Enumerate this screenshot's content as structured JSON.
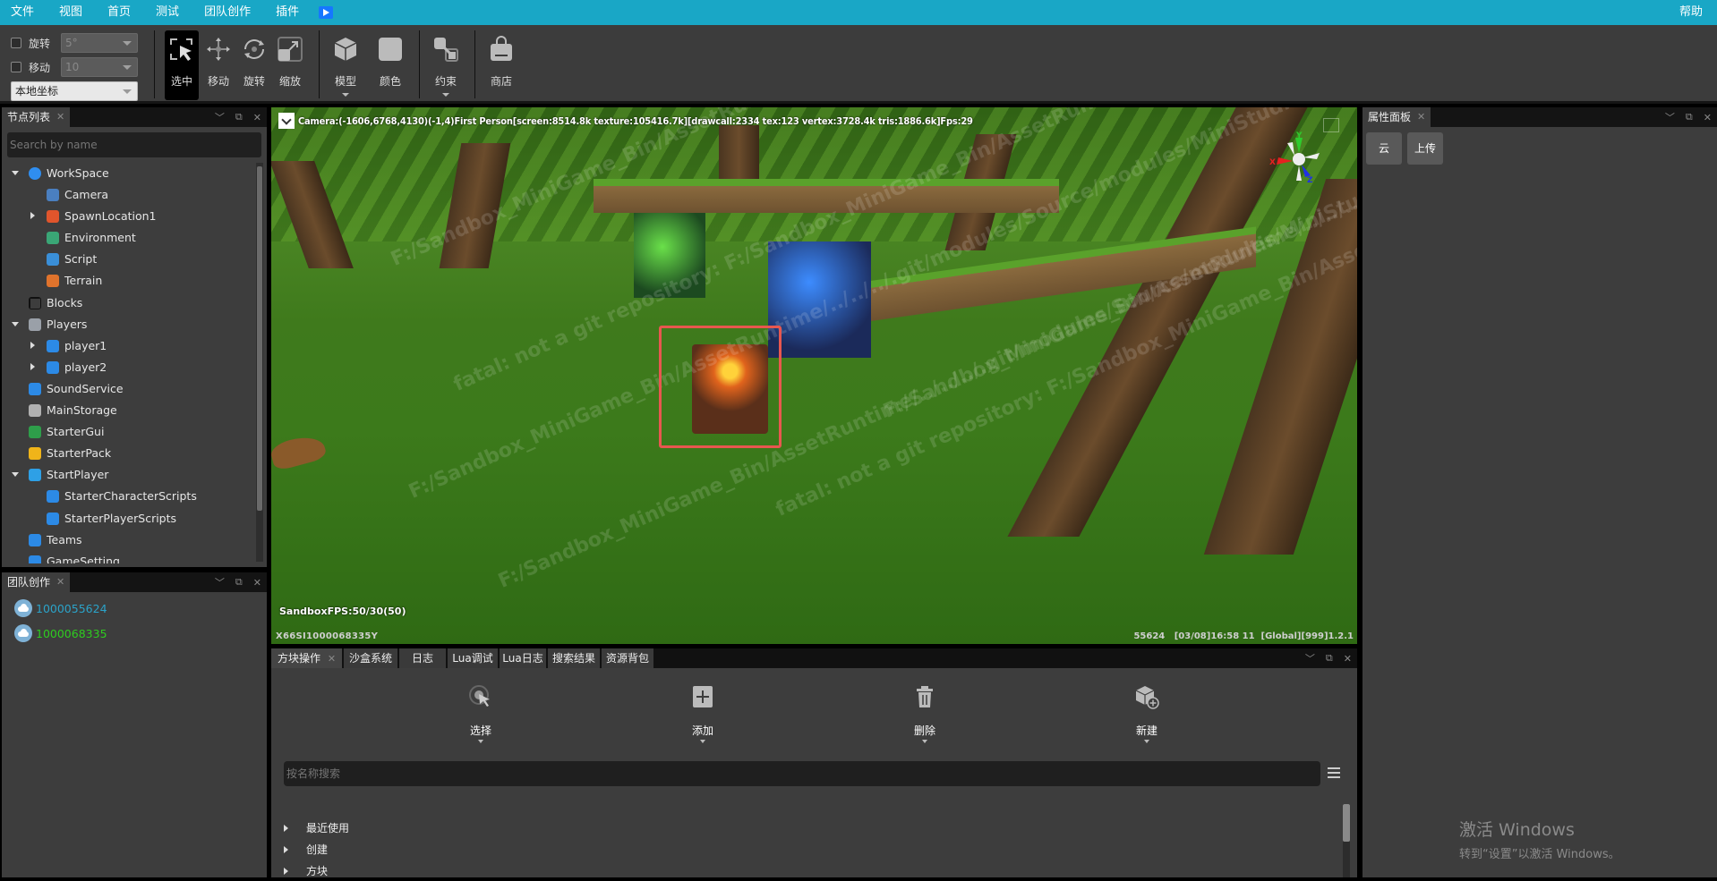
{
  "menubar": {
    "items": [
      "文件",
      "视图",
      "首页",
      "测试",
      "团队创作",
      "插件"
    ],
    "help": "帮助",
    "play_icon": "play-icon"
  },
  "toolbar": {
    "rotate_label": "旋转",
    "rotate_value": "5°",
    "move_label": "移动",
    "move_value": "10",
    "coord_mode": "本地坐标",
    "tools": [
      {
        "label": "选中",
        "icon": "select-cursor-icon",
        "active": true
      },
      {
        "label": "移动",
        "icon": "move-arrows-icon"
      },
      {
        "label": "旋转",
        "icon": "rotate-icon"
      },
      {
        "label": "缩放",
        "icon": "scale-icon"
      },
      {
        "label": "模型",
        "icon": "cube-icon",
        "dropdown": true
      },
      {
        "label": "颜色",
        "icon": "color-swatch-icon"
      },
      {
        "label": "约束",
        "icon": "constraint-icon",
        "dropdown": true
      },
      {
        "label": "商店",
        "icon": "shop-bag-icon"
      }
    ]
  },
  "node_panel": {
    "tab": "节点列表",
    "search_placeholder": "Search by name",
    "nodes": [
      {
        "label": "WorkSpace",
        "depth": 0,
        "toggle": "open",
        "icon": "globe-icon",
        "color": "#2f8ef0"
      },
      {
        "label": "Camera",
        "depth": 1,
        "toggle": "none",
        "icon": "camera-icon",
        "color": "#4a7fc0"
      },
      {
        "label": "SpawnLocation1",
        "depth": 1,
        "toggle": "closed",
        "icon": "spawn-pin-icon",
        "color": "#e0552c"
      },
      {
        "label": "Environment",
        "depth": 1,
        "toggle": "none",
        "icon": "environment-icon",
        "color": "#3aa676"
      },
      {
        "label": "Script",
        "depth": 1,
        "toggle": "none",
        "icon": "script-code-icon",
        "color": "#3a8fd8"
      },
      {
        "label": "Terrain",
        "depth": 1,
        "toggle": "none",
        "icon": "terrain-icon",
        "color": "#e0732c"
      },
      {
        "label": "Blocks",
        "depth": 0,
        "toggle": "none",
        "icon": "blocks-grid-icon",
        "color": "#111111"
      },
      {
        "label": "Players",
        "depth": 0,
        "toggle": "open",
        "icon": "gamepad-icon",
        "color": "#9aa0a8"
      },
      {
        "label": "player1",
        "depth": 1,
        "toggle": "closed",
        "icon": "player-cube-icon",
        "color": "#2c8ae6"
      },
      {
        "label": "player2",
        "depth": 1,
        "toggle": "closed",
        "icon": "player-cube-icon",
        "color": "#2c8ae6"
      },
      {
        "label": "SoundService",
        "depth": 0,
        "toggle": "none",
        "icon": "speaker-icon",
        "color": "#2c8ae6"
      },
      {
        "label": "MainStorage",
        "depth": 0,
        "toggle": "none",
        "icon": "storage-icon",
        "color": "#b0b0b0"
      },
      {
        "label": "StarterGui",
        "depth": 0,
        "toggle": "none",
        "icon": "gui-flag-icon",
        "color": "#2e9e4a"
      },
      {
        "label": "StarterPack",
        "depth": 0,
        "toggle": "none",
        "icon": "backpack-icon",
        "color": "#f0b419"
      },
      {
        "label": "StartPlayer",
        "depth": 0,
        "toggle": "open",
        "icon": "start-player-icon",
        "color": "#2ea0e6"
      },
      {
        "label": "StarterCharacterScripts",
        "depth": 1,
        "toggle": "none",
        "icon": "script-cube-icon",
        "color": "#2c8ae6"
      },
      {
        "label": "StarterPlayerScripts",
        "depth": 1,
        "toggle": "none",
        "icon": "script-cube-icon",
        "color": "#2c8ae6"
      },
      {
        "label": "Teams",
        "depth": 0,
        "toggle": "none",
        "icon": "teams-icon",
        "color": "#2c8ae6"
      },
      {
        "label": "GameSetting",
        "depth": 0,
        "toggle": "none",
        "icon": "settings-cube-icon",
        "color": "#2c8ae6"
      }
    ]
  },
  "team_panel": {
    "tab": "团队创作",
    "members": [
      {
        "id": "1000055624",
        "color": "#2ba3c9"
      },
      {
        "id": "1000068335",
        "color": "#2ecc1f"
      }
    ]
  },
  "viewport": {
    "camera_info": "Camera:(-1606,6768,4130)(-1,4)First Person[screen:8514.8k texture:105416.7k][drawcall:2334 tex:123 vertex:3728.4k tris:1886.6k]Fps:29",
    "sandbox_fps": "SandboxFPS:50/30(50)",
    "bottom_left": "X66SI1000068335Y",
    "bottom_right": "55624   [03/08]16:58 11  [Global][999]1.2.1",
    "watermark_lines": [
      "F:/Sandbox_MiniGame_Bin/AssetRuntime/../../../.git/modules/Source/modules/MiniStudio/modules/MiniGame_Bin/AssetRuntime",
      "fatal: not a git repository: F:/Sandbox_MiniGame_Bin/AssetRuntime/../../../.git/modules/Source/modules/MiniStudio"
    ],
    "gizmo_axes": {
      "x": "X",
      "y": "Y",
      "z": "Z"
    },
    "selection_color": "#e8574f"
  },
  "bottom_panel": {
    "tabs": [
      "方块操作",
      "沙盒系统",
      "日志",
      "Lua调试",
      "Lua日志",
      "搜索结果",
      "资源背包"
    ],
    "active_tab": 0,
    "actions": [
      {
        "label": "选择",
        "icon": "select-target-icon"
      },
      {
        "label": "添加",
        "icon": "add-plus-icon"
      },
      {
        "label": "删除",
        "icon": "trash-icon"
      },
      {
        "label": "新建",
        "icon": "new-block-icon"
      }
    ],
    "search_placeholder": "按名称搜索",
    "categories": [
      "最近使用",
      "创建",
      "方块"
    ]
  },
  "properties_panel": {
    "tab": "属性面板",
    "buttons": [
      "云",
      "上传"
    ]
  },
  "windows_activation": {
    "title": "激活 Windows",
    "subtitle": "转到“设置”以激活 Windows。"
  }
}
